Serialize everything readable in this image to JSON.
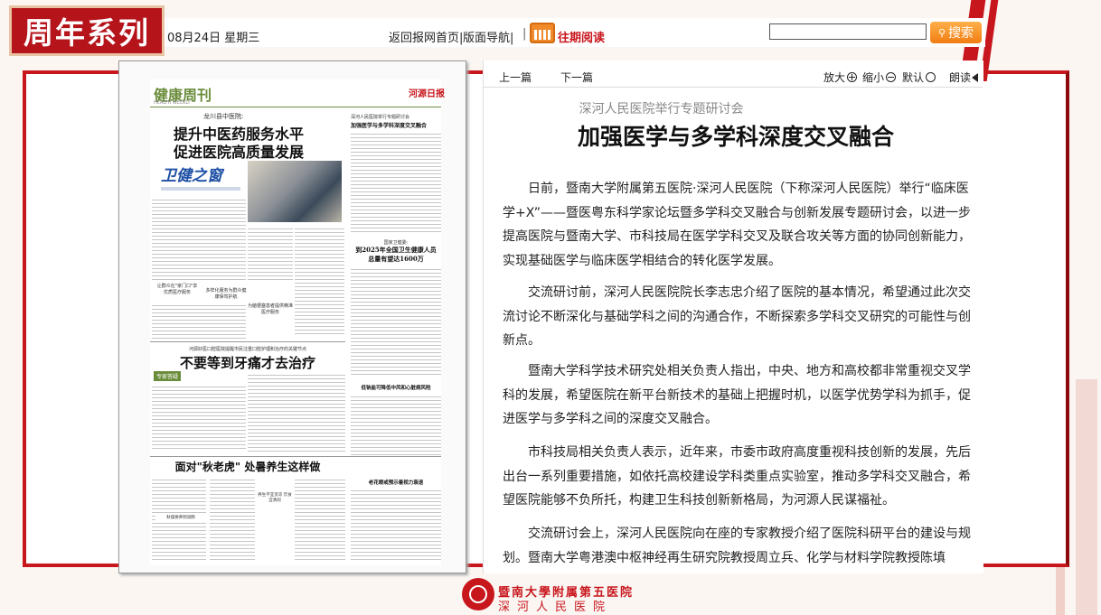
{
  "brand": {
    "badge": "周年系列",
    "footer_line1": "暨南大學附属第五医院",
    "footer_line2": "深河人民医院"
  },
  "topbar": {
    "date": "08月24日 星期三",
    "home_link": "返回报网首页|",
    "nav_link": "版面导航|",
    "separator": "|",
    "archive_link": "往期阅读",
    "search_placeholder": "",
    "search_button": "搜索"
  },
  "newspaper": {
    "section": "健康周刊",
    "section_en": "HEALTH WEEKLY",
    "masthead": "河源日报",
    "kicker1": "龙川县中医院:",
    "headline1a": "提升中医药服务水平",
    "headline1b": "促进医院高质量发展",
    "column_logo": "卫健之窗",
    "side_kicker": "深河人民医院举行专题研讨会",
    "side_head": "加强医学与多学科深度交叉融合",
    "mid_kicker": "国家卫健委:",
    "mid_head_a": "到2025年全国卫生健康人员",
    "mid_head_b": "总量有望达1600万",
    "box1": "让群众在\"家门口\"享优质医疗服务",
    "box2": "多样化服务为群众健康保驾护航",
    "box3": "为脑梗塞患者提供精准医疗服务",
    "kicker2": "河源好医口腔医院提醒市民注重口腔护理和治疗的关键节点",
    "headline2": "不要等到牙痛才去治疗",
    "tag2": "专家答疑",
    "side2_head": "低钠盐可降低中风和心脏病风险",
    "headline3": "面对\"秋老虎\" 处暑养生这样做",
    "side3_head": "老花眼或预示着视力衰退",
    "box4": "秋燥要养阴润肺",
    "box5": "养生不宜贪凉 饮食宜清润"
  },
  "article_nav": {
    "prev": "上一篇",
    "next": "下一篇",
    "zoom_in": "放大",
    "zoom_out": "缩小",
    "default": "默认",
    "read": "朗读"
  },
  "article": {
    "subtitle": "深河人民医院举行专题研讨会",
    "title": "加强医学与多学科深度交叉融合",
    "paragraphs": [
      "日前，暨南大学附属第五医院·深河人民医院（下称深河人民医院）举行“临床医学+X”——暨医粤东科学家论坛暨多学科交叉融合与创新发展专题研讨会，以进一步提高医院与暨南大学、市科技局在医学学科交叉及联合攻关等方面的协同创新能力，实现基础医学与临床医学相结合的转化医学发展。",
      "交流研讨前，深河人民医院院长李志忠介绍了医院的基本情况，希望通过此次交流讨论不断深化与基础学科之间的沟通合作，不断探索多学科交叉研究的可能性与创新点。",
      "暨南大学科学技术研究处相关负责人指出，中央、地方和高校都非常重视交叉学科的发展，希望医院在新平台新技术的基础上把握时机，以医学优势学科为抓手，促进医学与多学科之间的深度交叉融合。",
      "市科技局相关负责人表示，近年来，市委市政府高度重视科技创新的发展，先后出台一系列重要措施，如依托高校建设学科类重点实验室，推动多学科交叉融合，希望医院能够不负所托，构建卫生科技创新新格局，为河源人民谋福祉。",
      "交流研讨会上，深河人民医院向在座的专家教授介绍了医院科研平台的建设与规划。暨南大学粤港澳中枢神经再生研究院教授周立兵、化学与材料学院教授陈填"
    ]
  }
}
